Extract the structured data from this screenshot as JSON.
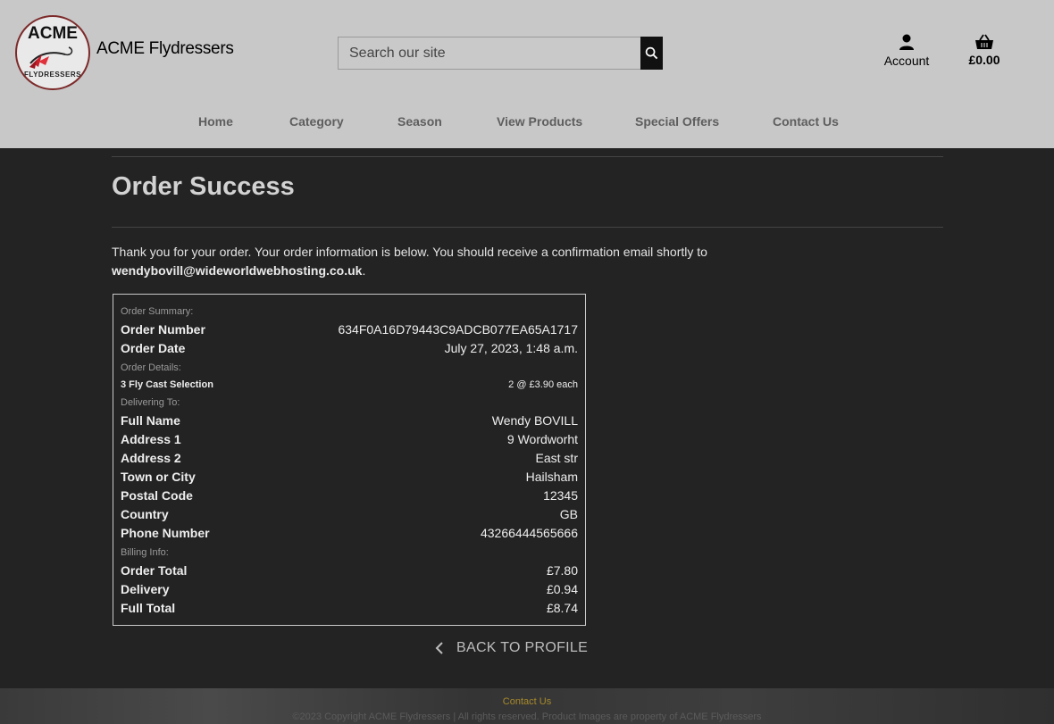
{
  "brand": {
    "logo_top": "ACME",
    "logo_bottom": "FLYDRESSERS",
    "name": "ACME Flydressers"
  },
  "search": {
    "placeholder": "Search our site"
  },
  "header": {
    "account_label": "Account",
    "cart_total": "£0.00"
  },
  "nav": {
    "items": [
      "Home",
      "Category",
      "Season",
      "View Products",
      "Special Offers",
      "Contact Us"
    ]
  },
  "page": {
    "title": "Order Success",
    "intro": "Thank you for your order. Your order information is below. You should receive a confirmation email shortly to",
    "email": "wendybovill@wideworldwebhosting.co.uk",
    "email_suffix": "."
  },
  "summary": {
    "order_summary_heading": "Order Summary:",
    "order_number_label": "Order Number",
    "order_number": "634F0A16D79443C9ADCB077EA65A1717",
    "order_date_label": "Order Date",
    "order_date": "July 27, 2023, 1:48 a.m.",
    "order_details_heading": "Order Details:",
    "item_name": "3 Fly Cast Selection",
    "item_qty": "2 @ £3.90 each",
    "delivering_heading": "Delivering To:",
    "full_name_label": "Full Name",
    "full_name": "Wendy BOVILL",
    "address1_label": "Address 1",
    "address1": "9 Wordworht",
    "address2_label": "Address 2",
    "address2": "East str",
    "town_label": "Town or City",
    "town": "Hailsham",
    "postal_label": "Postal Code",
    "postal": "12345",
    "country_label": "Country",
    "country": "GB",
    "phone_label": "Phone Number",
    "phone": "43266444565666",
    "billing_heading": "Billing Info:",
    "order_total_label": "Order Total",
    "order_total": "£7.80",
    "delivery_label": "Delivery",
    "delivery": "£0.94",
    "full_total_label": "Full Total",
    "full_total": "£8.74"
  },
  "back_button": "BACK TO PROFILE",
  "footer": {
    "contact": "Contact Us",
    "copyright": "©2023 Copyright ACME Flydressers | All rights reserved. Product Images are property of ACME Flydressers"
  }
}
